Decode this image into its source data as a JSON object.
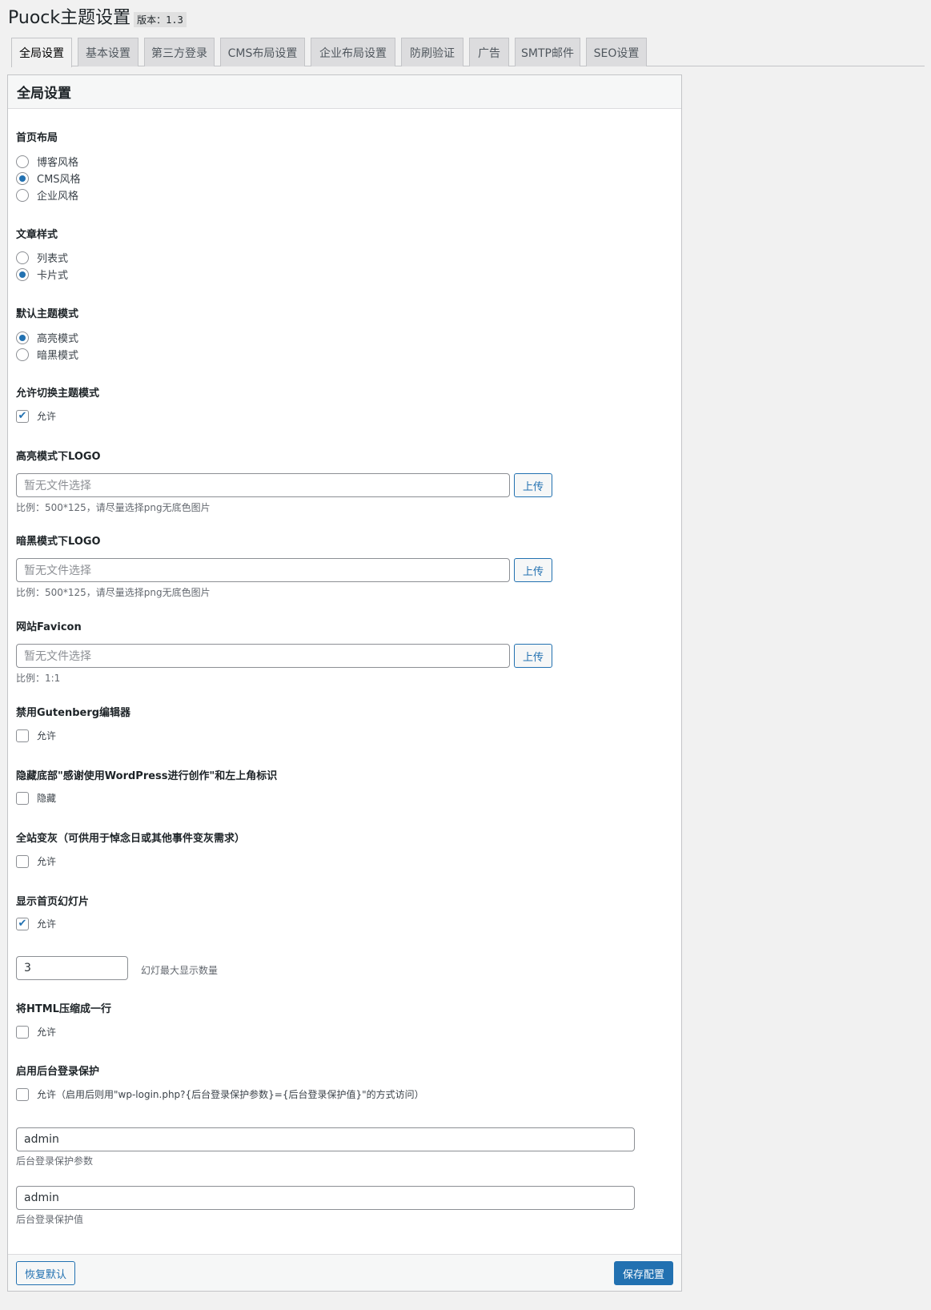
{
  "header": {
    "title": "Puock主题设置",
    "version": "版本：1.3"
  },
  "tabs": [
    "全局设置",
    "基本设置",
    "第三方登录",
    "CMS布局设置",
    "企业布局设置",
    "防刷验证",
    "广告",
    "SMTP邮件",
    "SEO设置"
  ],
  "active_tab": "全局设置",
  "panel": {
    "title": "全局设置"
  },
  "sections": {
    "home_layout": {
      "label": "首页布局",
      "options": [
        "博客风格",
        "CMS风格",
        "企业风格"
      ],
      "selected": "CMS风格"
    },
    "post_style": {
      "label": "文章样式",
      "options": [
        "列表式",
        "卡片式"
      ],
      "selected": "卡片式"
    },
    "theme_mode": {
      "label": "默认主题模式",
      "options": [
        "高亮模式",
        "暗黑模式"
      ],
      "selected": "高亮模式"
    },
    "allow_switch": {
      "label": "允许切换主题模式",
      "option": "允许",
      "checked": true
    },
    "light_logo": {
      "label": "高亮模式下LOGO",
      "placeholder": "暂无文件选择",
      "button": "上传",
      "desc": "比例：500*125，请尽量选择png无底色图片"
    },
    "dark_logo": {
      "label": "暗黑模式下LOGO",
      "placeholder": "暂无文件选择",
      "button": "上传",
      "desc": "比例：500*125，请尽量选择png无底色图片"
    },
    "favicon": {
      "label": "网站Favicon",
      "placeholder": "暂无文件选择",
      "button": "上传",
      "desc": "比例：1:1"
    },
    "disable_gutenberg": {
      "label": "禁用Gutenberg编辑器",
      "option": "允许",
      "checked": false
    },
    "hide_footer": {
      "label": "隐藏底部\"感谢使用WordPress进行创作\"和左上角标识",
      "option": "隐藏",
      "checked": false
    },
    "grayscale": {
      "label": "全站变灰（可供用于悼念日或其他事件变灰需求）",
      "option": "允许",
      "checked": false
    },
    "slider": {
      "label": "显示首页幻灯片",
      "option": "允许",
      "checked": true,
      "count": "3",
      "count_desc": "幻灯最大显示数量"
    },
    "compress_html": {
      "label": "将HTML压缩成一行",
      "option": "允许",
      "checked": false
    },
    "login_protect": {
      "label": "启用后台登录保护",
      "option": "允许（启用后则用\"wp-login.php?{后台登录保护参数}={后台登录保护值}\"的方式访问）",
      "checked": false,
      "param_value": "admin",
      "param_desc": "后台登录保护参数",
      "value_value": "admin",
      "value_desc": "后台登录保护值"
    }
  },
  "footer": {
    "reset_label": "恢复默认",
    "save_label": "保存配置"
  },
  "colors": {
    "accent": "#2271b1",
    "background": "#f1f1f1"
  }
}
